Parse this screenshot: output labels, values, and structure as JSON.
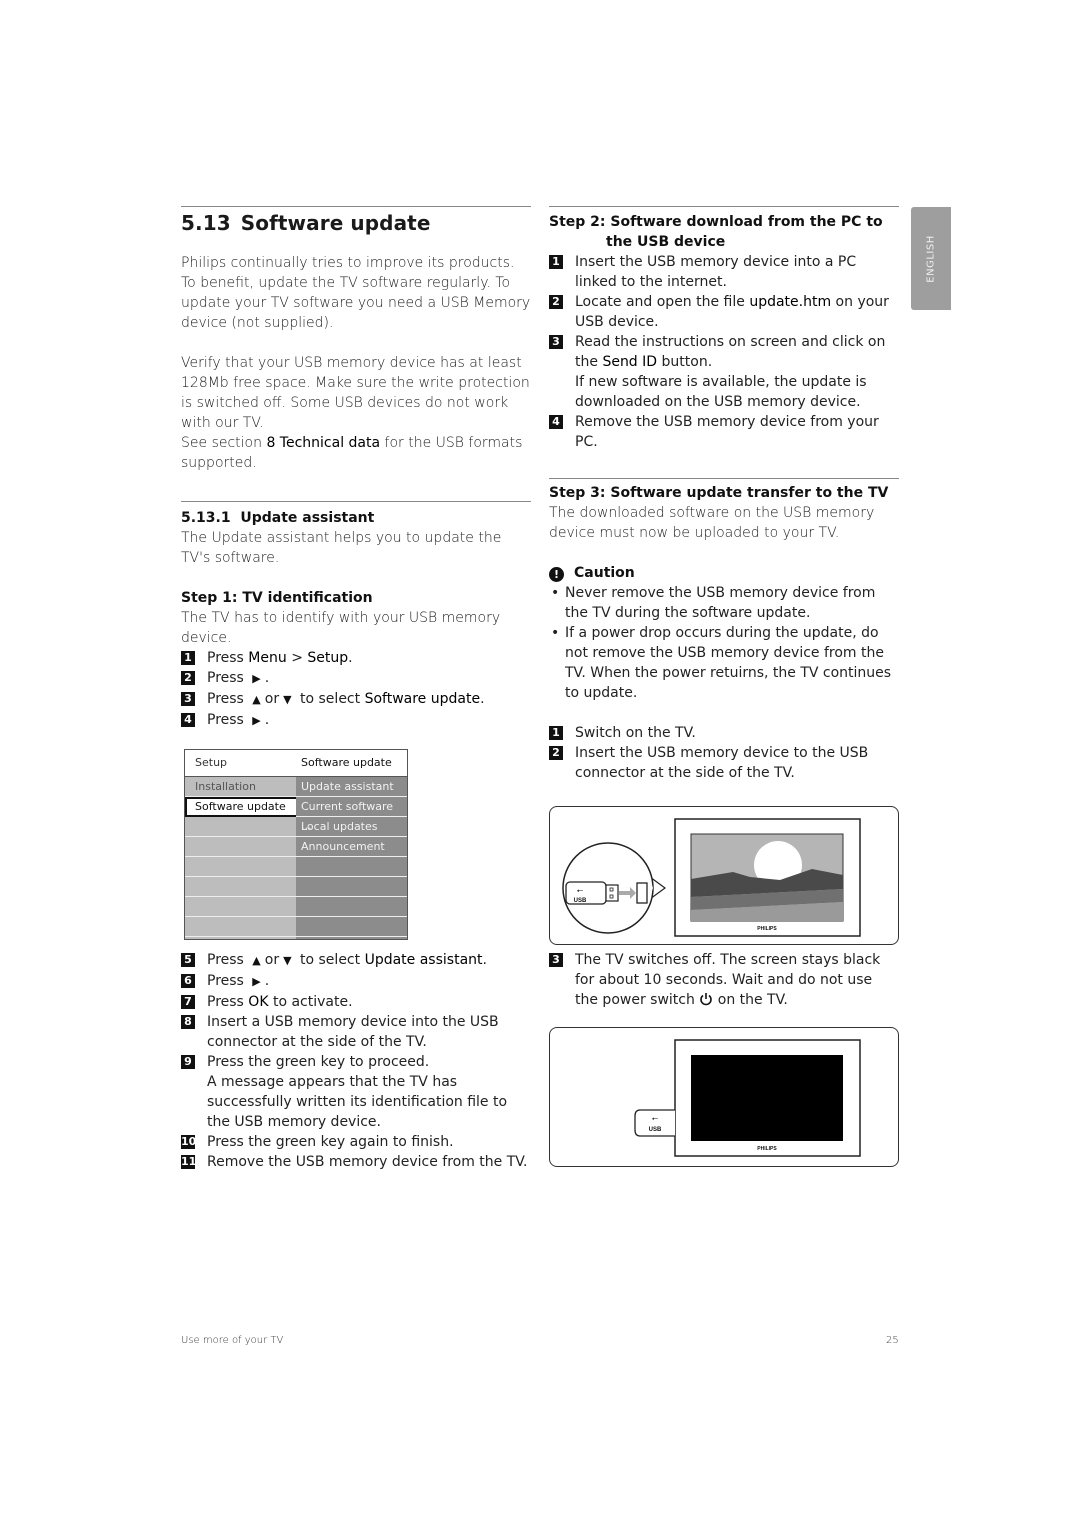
{
  "section": {
    "number": "5.13",
    "title": "Software update",
    "intro_p1": "Philips continually tries to improve its products. To benefit, update the TV software regularly. To update your TV software you need a USB Memory device (not supplied).",
    "intro_p2": "Verify that your USB memory device has at least 128Mb free space. Make sure the write protection is switched off. Some USB devices do not work with our TV.",
    "intro_p3_pre": "See section ",
    "intro_p3_link": "8 Technical data",
    "intro_p3_post": " for the USB formats supported."
  },
  "subsection": {
    "number": "5.13.1",
    "title": "Update assistant",
    "desc": "The Update assistant helps you to update the TV's software."
  },
  "step1": {
    "title": "Step 1: TV identification",
    "desc": "The TV has to identify with your USB memory device.",
    "items_a": [
      {
        "n": "1",
        "pre": "Press ",
        "b1": "Menu",
        "mid": " > ",
        "b2": "Setup",
        "post": "."
      },
      {
        "n": "2",
        "pre": "Press ",
        "arrow": "▶",
        "post": "."
      },
      {
        "n": "3",
        "pre": "Press ",
        "arrow_up": "▲",
        "or": " or ",
        "arrow_down": "▼",
        "mid": " to select ",
        "b1": "Software update",
        "post": "."
      },
      {
        "n": "4",
        "pre": "Press ",
        "arrow": "▶",
        "post": "."
      }
    ],
    "items_b": [
      {
        "n": "5",
        "pre": "Press ",
        "arrow_up": "▲",
        "or": " or ",
        "arrow_down": "▼",
        "mid": " to select ",
        "b1": "Update assistant",
        "post": "."
      },
      {
        "n": "6",
        "pre": "Press ",
        "arrow": "▶",
        "post": "."
      },
      {
        "n": "7",
        "pre": "Press ",
        "b1": "OK",
        "post": " to activate."
      },
      {
        "n": "8",
        "text": "Insert a USB memory device into the USB connector at the side of the TV."
      },
      {
        "n": "9",
        "text": "Press the green key to proceed.",
        "extra": "A message appears that the TV has successfully written its identification file to the USB memory device."
      },
      {
        "n": "10",
        "text": "Press the green key again to finish."
      },
      {
        "n": "11",
        "text": "Remove the USB memory device from the TV."
      }
    ]
  },
  "menu": {
    "left_header": "Setup",
    "right_header": "Software update",
    "left_items": [
      "Installation",
      "Software update",
      "",
      "",
      "",
      "",
      "",
      ""
    ],
    "right_items": [
      "Update assistant",
      "Current software ...",
      "Local updates",
      "Announcement",
      "",
      "",
      "",
      ""
    ],
    "selected_left": "Software update"
  },
  "step2": {
    "title_a": "Step 2: Software download from the PC to",
    "title_b": "the USB device",
    "items": [
      {
        "n": "1",
        "text": "Insert the USB memory device into a PC linked to the internet."
      },
      {
        "n": "2",
        "pre": "Locate and open the file ",
        "b1": "update.htm",
        "post": " on your USB device."
      },
      {
        "n": "3",
        "pre": "Read the instructions on screen and click on the ",
        "b1": "Send ID",
        "post": " button.",
        "extra": "If new software is available, the update is downloaded on the USB memory device."
      },
      {
        "n": "4",
        "text": "Remove the USB memory device from your PC."
      }
    ]
  },
  "step3": {
    "title": "Step 3: Software update transfer to the TV",
    "desc": "The downloaded software on the USB memory device must now be uploaded to your TV.",
    "caution_title": "Caution",
    "caution_items": [
      "Never remove the USB memory device from the TV during the software update.",
      "If a power drop occurs during the update, do not remove the USB memory device from the TV. When the power retuirns, the TV continues to update."
    ],
    "items": [
      {
        "n": "1",
        "text": "Switch on the TV."
      },
      {
        "n": "2",
        "text": "Insert the USB memory device to the USB connector at the side of the TV."
      }
    ],
    "item3": {
      "n": "3",
      "pre": "The TV switches off. The screen stays black for about 10 seconds. Wait and do not use the power switch ",
      "post": " on the TV."
    }
  },
  "illustration": {
    "usb_label": "USB",
    "brand": "PHILIPS"
  },
  "sidetab": "ENGLISH",
  "footer": {
    "left": "Use more of your TV",
    "page": "25"
  }
}
